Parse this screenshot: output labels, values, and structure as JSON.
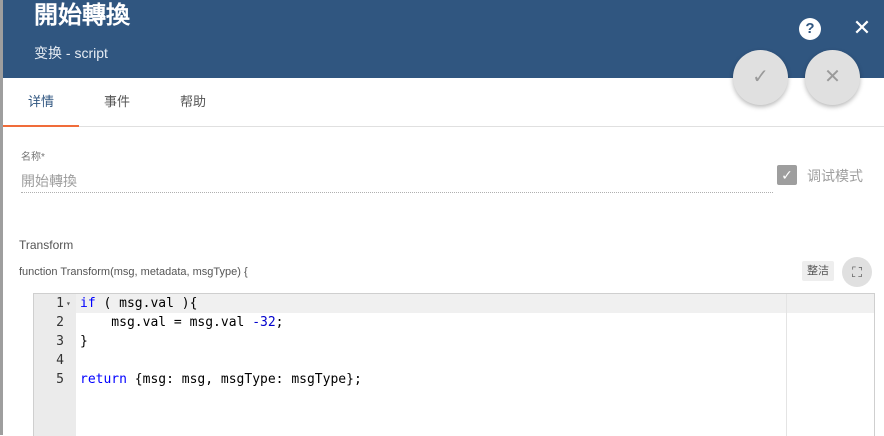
{
  "header": {
    "title": "開始轉換",
    "subtitle": "变换 - script",
    "help_icon": "?",
    "close_icon": "✕",
    "background": "#305680"
  },
  "fab": {
    "confirm_icon": "✓",
    "cancel_icon": "✕"
  },
  "tabs": [
    {
      "label": "详情",
      "active": true
    },
    {
      "label": "事件",
      "active": false
    },
    {
      "label": "帮助",
      "active": false
    }
  ],
  "name_field": {
    "label": "名称",
    "required_mark": "*",
    "value": "開始轉換"
  },
  "debug_mode": {
    "label": "调试模式",
    "checked": true,
    "check_icon": "✓"
  },
  "transform": {
    "section_label": "Transform",
    "function_signature": "function Transform(msg, metadata, msgType) {",
    "tidy_label": "整洁",
    "fullscreen_icon": "⛶"
  },
  "editor": {
    "active_line": 1,
    "lines": [
      {
        "number": "1",
        "fold": "▾",
        "tokens": [
          {
            "t": "if",
            "c": "kw"
          },
          {
            "t": " ( msg.val ){",
            "c": ""
          }
        ]
      },
      {
        "number": "2",
        "fold": "",
        "tokens": [
          {
            "t": "    msg.val = msg.val ",
            "c": ""
          },
          {
            "t": "-32",
            "c": "num"
          },
          {
            "t": ";",
            "c": ""
          }
        ]
      },
      {
        "number": "3",
        "fold": "",
        "tokens": [
          {
            "t": "}",
            "c": ""
          }
        ]
      },
      {
        "number": "4",
        "fold": "",
        "tokens": []
      },
      {
        "number": "5",
        "fold": "",
        "tokens": [
          {
            "t": "return",
            "c": "kw"
          },
          {
            "t": " {msg: msg, msgType: msgType};",
            "c": ""
          }
        ]
      }
    ]
  },
  "colors": {
    "accent_tab": "#f06c3a",
    "keyword": "#0000ff"
  }
}
